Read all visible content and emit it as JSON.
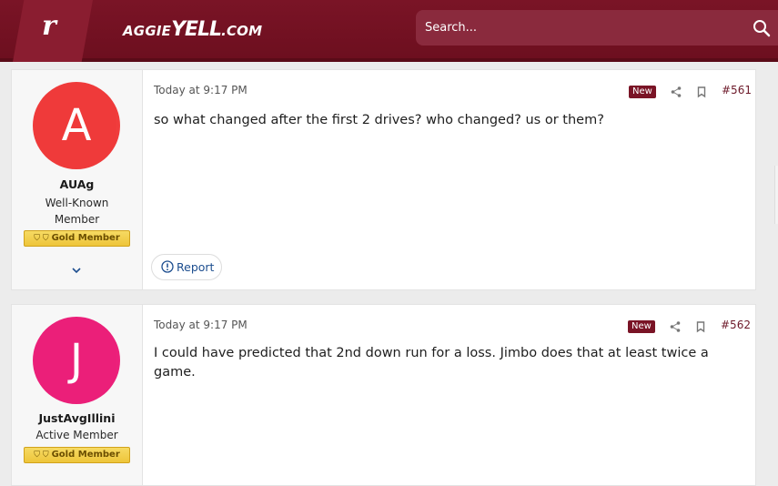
{
  "header": {
    "logo_letter": "r",
    "site_name_prefix": "AGGIE",
    "site_name_main": "YELL",
    "site_name_suffix": ".COM",
    "search_placeholder": "Search...",
    "bg_color": "#6d0f1f"
  },
  "posts": [
    {
      "avatar_letter": "A",
      "avatar_color": "#ef2b2b",
      "username": "AUAg",
      "user_title": "Well-Known Member",
      "badge": "Gold Member",
      "date": "Today at 9:17 PM",
      "new_label": "New",
      "post_number": "#561",
      "body": "so what changed after the first 2 drives? who changed? us or them?",
      "report_label": "Report"
    },
    {
      "avatar_letter": "J",
      "avatar_color": "#ea0d6f",
      "username": "JustAvgIllini",
      "user_title": "Active Member",
      "badge": "Gold Member",
      "date": "Today at 9:17 PM",
      "new_label": "New",
      "post_number": "#562",
      "body": "I could have predicted that 2nd down run for a loss. Jimbo does that at least twice a game."
    }
  ]
}
